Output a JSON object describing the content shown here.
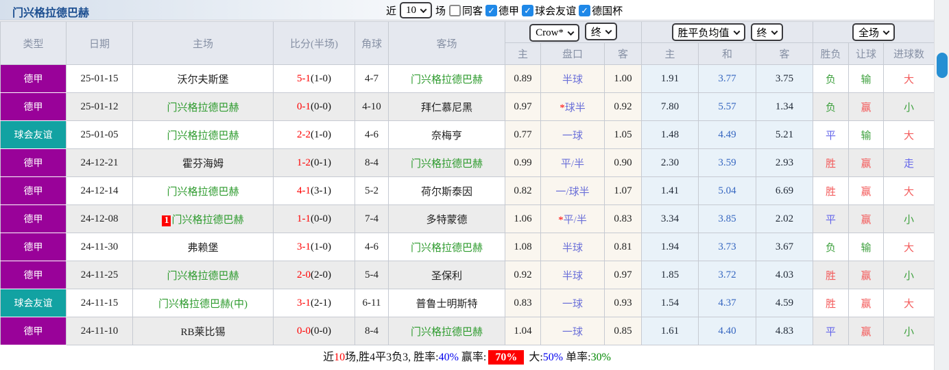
{
  "title": "门兴格拉德巴赫",
  "topbar": {
    "near_label": "近",
    "matches_count": "10",
    "games_label": "场",
    "filters": [
      {
        "label": "同客",
        "checked": false
      },
      {
        "label": "德甲",
        "checked": true
      },
      {
        "label": "球会友谊",
        "checked": true
      },
      {
        "label": "德国杯",
        "checked": true
      }
    ]
  },
  "header": {
    "columns": [
      "类型",
      "日期",
      "主场",
      "比分(半场)",
      "角球",
      "客场"
    ],
    "odds_source_select": "Crow*",
    "odds_time_select": "终",
    "avg_select": "胜平负均值",
    "avg_time_select": "终",
    "scope_select": "全场",
    "odds_sub": [
      "主",
      "盘口",
      "客"
    ],
    "avg_sub": [
      "主",
      "和",
      "客"
    ],
    "result_sub": [
      "胜负",
      "让球",
      "进球数"
    ]
  },
  "colors": {
    "league_badge": "#990299",
    "friendly_badge": "#12a2a2",
    "subject_team": "#2e9b2e",
    "score_red": "#fe0000",
    "handicap_text": "#6a6fd8",
    "avg_mid_blue": "#3465c0",
    "result_red": "#f35b5b",
    "result_green": "#3fa13f",
    "result_blue": "#6466ea",
    "scroll_thumb": "#268fd3"
  },
  "rows": [
    {
      "league": "德甲",
      "league_class": "league",
      "date": "25-01-15",
      "home": "沃尔夫斯堡",
      "home_subject": false,
      "home_badge": "",
      "score": "5-1",
      "half": "(1-0)",
      "corners": "4-7",
      "away": "门兴格拉德巴赫",
      "away_subject": true,
      "odds_home": "0.89",
      "handicap": "半球",
      "handicap_star": false,
      "odds_away": "1.00",
      "avg_home": "1.91",
      "avg_draw": "3.77",
      "avg_away": "3.75",
      "outcome": "负",
      "outcome_color": "green",
      "handicap_result": "输",
      "handicap_result_color": "green",
      "goals": "大",
      "goals_color": "red"
    },
    {
      "league": "德甲",
      "league_class": "league",
      "date": "25-01-12",
      "home": "门兴格拉德巴赫",
      "home_subject": true,
      "home_badge": "",
      "score": "0-1",
      "half": "(0-0)",
      "corners": "4-10",
      "away": "拜仁慕尼黑",
      "away_subject": false,
      "odds_home": "0.97",
      "handicap": "球半",
      "handicap_star": true,
      "odds_away": "0.92",
      "avg_home": "7.80",
      "avg_draw": "5.57",
      "avg_away": "1.34",
      "outcome": "负",
      "outcome_color": "green",
      "handicap_result": "赢",
      "handicap_result_color": "red",
      "goals": "小",
      "goals_color": "green"
    },
    {
      "league": "球会友谊",
      "league_class": "friendly",
      "date": "25-01-05",
      "home": "门兴格拉德巴赫",
      "home_subject": true,
      "home_badge": "",
      "score": "2-2",
      "half": "(1-0)",
      "corners": "4-6",
      "away": "奈梅亨",
      "away_subject": false,
      "odds_home": "0.77",
      "handicap": "一球",
      "handicap_star": false,
      "odds_away": "1.05",
      "avg_home": "1.48",
      "avg_draw": "4.49",
      "avg_away": "5.21",
      "outcome": "平",
      "outcome_color": "blue",
      "handicap_result": "输",
      "handicap_result_color": "green",
      "goals": "大",
      "goals_color": "red"
    },
    {
      "league": "德甲",
      "league_class": "league",
      "date": "24-12-21",
      "home": "霍芬海姆",
      "home_subject": false,
      "home_badge": "",
      "score": "1-2",
      "half": "(0-1)",
      "corners": "8-4",
      "away": "门兴格拉德巴赫",
      "away_subject": true,
      "odds_home": "0.99",
      "handicap": "平/半",
      "handicap_star": false,
      "odds_away": "0.90",
      "avg_home": "2.30",
      "avg_draw": "3.59",
      "avg_away": "2.93",
      "outcome": "胜",
      "outcome_color": "red",
      "handicap_result": "赢",
      "handicap_result_color": "red",
      "goals": "走",
      "goals_color": "blue"
    },
    {
      "league": "德甲",
      "league_class": "league",
      "date": "24-12-14",
      "home": "门兴格拉德巴赫",
      "home_subject": true,
      "home_badge": "",
      "score": "4-1",
      "half": "(3-1)",
      "corners": "5-2",
      "away": "荷尔斯泰因",
      "away_subject": false,
      "odds_home": "0.82",
      "handicap": "一/球半",
      "handicap_star": false,
      "odds_away": "1.07",
      "avg_home": "1.41",
      "avg_draw": "5.04",
      "avg_away": "6.69",
      "outcome": "胜",
      "outcome_color": "red",
      "handicap_result": "赢",
      "handicap_result_color": "red",
      "goals": "大",
      "goals_color": "red"
    },
    {
      "league": "德甲",
      "league_class": "league",
      "date": "24-12-08",
      "home": "门兴格拉德巴赫",
      "home_subject": true,
      "home_badge": "1",
      "score": "1-1",
      "half": "(0-0)",
      "corners": "7-4",
      "away": "多特蒙德",
      "away_subject": false,
      "odds_home": "1.06",
      "handicap": "平/半",
      "handicap_star": true,
      "odds_away": "0.83",
      "avg_home": "3.34",
      "avg_draw": "3.85",
      "avg_away": "2.02",
      "outcome": "平",
      "outcome_color": "blue",
      "handicap_result": "赢",
      "handicap_result_color": "red",
      "goals": "小",
      "goals_color": "green"
    },
    {
      "league": "德甲",
      "league_class": "league",
      "date": "24-11-30",
      "home": "弗赖堡",
      "home_subject": false,
      "home_badge": "",
      "score": "3-1",
      "half": "(1-0)",
      "corners": "4-6",
      "away": "门兴格拉德巴赫",
      "away_subject": true,
      "odds_home": "1.08",
      "handicap": "半球",
      "handicap_star": false,
      "odds_away": "0.81",
      "avg_home": "1.94",
      "avg_draw": "3.73",
      "avg_away": "3.67",
      "outcome": "负",
      "outcome_color": "green",
      "handicap_result": "输",
      "handicap_result_color": "green",
      "goals": "大",
      "goals_color": "red"
    },
    {
      "league": "德甲",
      "league_class": "league",
      "date": "24-11-25",
      "home": "门兴格拉德巴赫",
      "home_subject": true,
      "home_badge": "",
      "score": "2-0",
      "half": "(2-0)",
      "corners": "5-4",
      "away": "圣保利",
      "away_subject": false,
      "odds_home": "0.92",
      "handicap": "半球",
      "handicap_star": false,
      "odds_away": "0.97",
      "avg_home": "1.85",
      "avg_draw": "3.72",
      "avg_away": "4.03",
      "outcome": "胜",
      "outcome_color": "red",
      "handicap_result": "赢",
      "handicap_result_color": "red",
      "goals": "小",
      "goals_color": "green"
    },
    {
      "league": "球会友谊",
      "league_class": "friendly",
      "date": "24-11-15",
      "home": "门兴格拉德巴赫(中)",
      "home_subject": true,
      "home_badge": "",
      "score": "3-1",
      "half": "(2-1)",
      "corners": "6-11",
      "away": "普鲁士明斯特",
      "away_subject": false,
      "odds_home": "0.83",
      "handicap": "一球",
      "handicap_star": false,
      "odds_away": "0.93",
      "avg_home": "1.54",
      "avg_draw": "4.37",
      "avg_away": "4.59",
      "outcome": "胜",
      "outcome_color": "red",
      "handicap_result": "赢",
      "handicap_result_color": "red",
      "goals": "大",
      "goals_color": "red"
    },
    {
      "league": "德甲",
      "league_class": "league",
      "date": "24-11-10",
      "home": "RB莱比锡",
      "home_subject": false,
      "home_badge": "",
      "score": "0-0",
      "half": "(0-0)",
      "corners": "8-4",
      "away": "门兴格拉德巴赫",
      "away_subject": true,
      "odds_home": "1.04",
      "handicap": "一球",
      "handicap_star": false,
      "odds_away": "0.85",
      "avg_home": "1.61",
      "avg_draw": "4.40",
      "avg_away": "4.83",
      "outcome": "平",
      "outcome_color": "blue",
      "handicap_result": "赢",
      "handicap_result_color": "red",
      "goals": "小",
      "goals_color": "green"
    }
  ],
  "footer": {
    "segments": [
      {
        "text": "近",
        "style": "plain"
      },
      {
        "text": "10",
        "style": "red"
      },
      {
        "text": "场,胜4平3负3, 胜率:",
        "style": "plain"
      },
      {
        "text": "40%",
        "style": "blue"
      },
      {
        "text": " 赢率:",
        "style": "plain"
      },
      {
        "text": "70%",
        "style": "badge"
      },
      {
        "text": " 大:",
        "style": "plain"
      },
      {
        "text": "50%",
        "style": "blue"
      },
      {
        "text": " 单率:",
        "style": "plain"
      },
      {
        "text": "30%",
        "style": "green"
      }
    ]
  }
}
